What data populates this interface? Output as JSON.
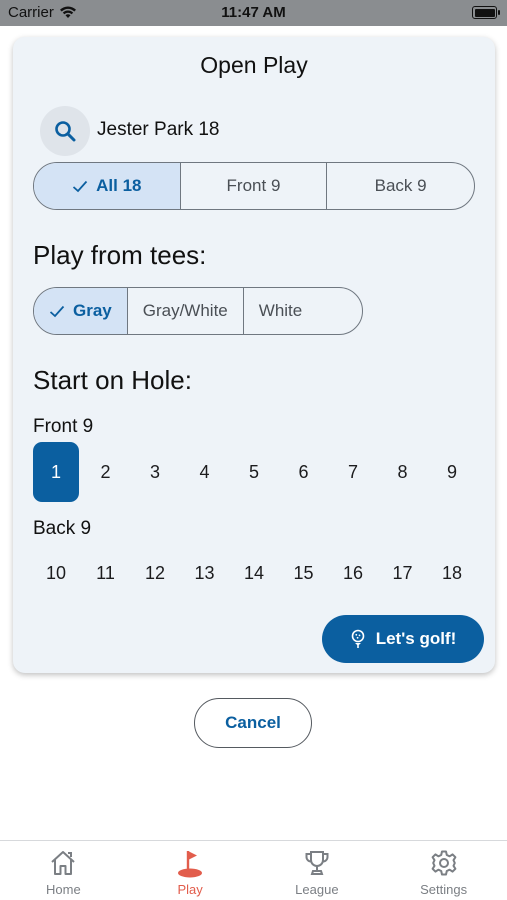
{
  "status_bar": {
    "carrier": "Carrier",
    "time": "11:47 AM"
  },
  "card": {
    "title": "Open Play",
    "course": "Jester Park 18",
    "hole_options": [
      {
        "label": "All 18",
        "selected": true
      },
      {
        "label": "Front 9",
        "selected": false
      },
      {
        "label": "Back 9",
        "selected": false
      }
    ],
    "tees_heading": "Play from tees:",
    "tee_options": [
      {
        "label": "Gray",
        "selected": true
      },
      {
        "label": "Gray/White",
        "selected": false
      },
      {
        "label": "White",
        "selected": false
      }
    ],
    "start_heading": "Start on Hole:",
    "front_label": "Front 9",
    "front_holes": [
      "1",
      "2",
      "3",
      "4",
      "5",
      "6",
      "7",
      "8",
      "9"
    ],
    "back_label": "Back 9",
    "back_holes": [
      "10",
      "11",
      "12",
      "13",
      "14",
      "15",
      "16",
      "17",
      "18"
    ],
    "selected_hole": "1",
    "lets_golf_label": "Let's golf!"
  },
  "cancel_label": "Cancel",
  "tabs": [
    {
      "label": "Home",
      "icon": "home-icon",
      "active": false
    },
    {
      "label": "Play",
      "icon": "golf-flag-icon",
      "active": true
    },
    {
      "label": "League",
      "icon": "trophy-icon",
      "active": false
    },
    {
      "label": "Settings",
      "icon": "gear-icon",
      "active": false
    }
  ],
  "colors": {
    "accent": "#0b5fa0",
    "active_tab": "#e25d4c",
    "selected_fill": "#d4e3f5"
  }
}
